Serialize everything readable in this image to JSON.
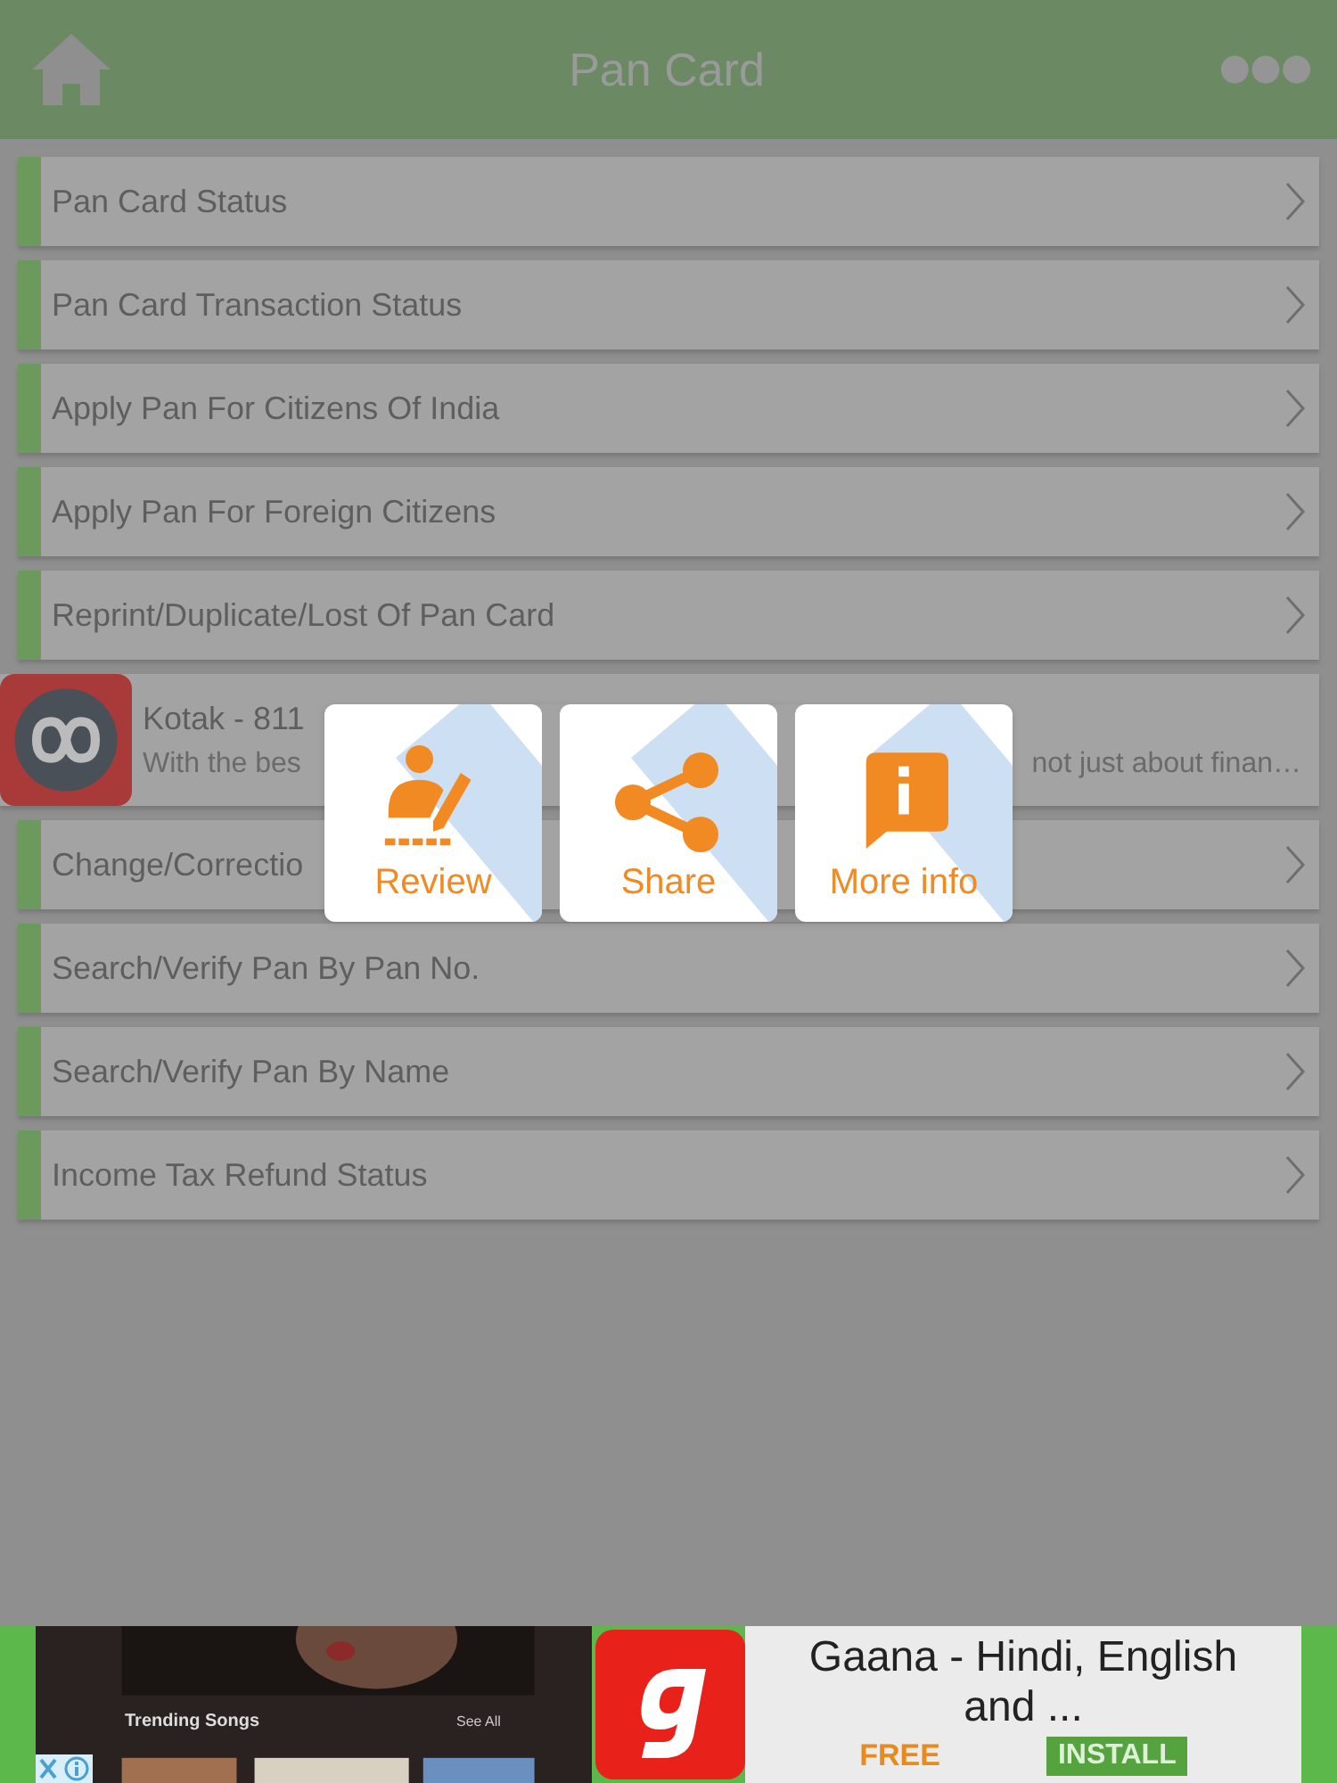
{
  "header": {
    "title": "Pan Card"
  },
  "list": [
    {
      "kind": "link",
      "label": "Pan Card Status"
    },
    {
      "kind": "link",
      "label": "Pan Card Transaction Status"
    },
    {
      "kind": "link",
      "label": "Apply Pan For Citizens Of India"
    },
    {
      "kind": "link",
      "label": "Apply Pan For Foreign Citizens"
    },
    {
      "kind": "link",
      "label": "Reprint/Duplicate/Lost Of Pan Card"
    },
    {
      "kind": "ad",
      "label": "Kotak - 811",
      "desc_left": "With the bes",
      "desc_right": "not just about finan…"
    },
    {
      "kind": "link",
      "label": "Change/Correctio"
    },
    {
      "kind": "link",
      "label": "Search/Verify Pan By Pan No."
    },
    {
      "kind": "link",
      "label": "Search/Verify Pan By Name"
    },
    {
      "kind": "link",
      "label": "Income Tax Refund Status"
    }
  ],
  "popup": [
    {
      "kind": "review",
      "label": "Review"
    },
    {
      "kind": "share",
      "label": "Share"
    },
    {
      "kind": "info",
      "label": "More info"
    }
  ],
  "banner": {
    "screenshot_title": "Trending Songs",
    "screenshot_link": "See All",
    "title": "Gaana - Hindi, English and ...",
    "price": "FREE",
    "button": "INSTALL"
  }
}
